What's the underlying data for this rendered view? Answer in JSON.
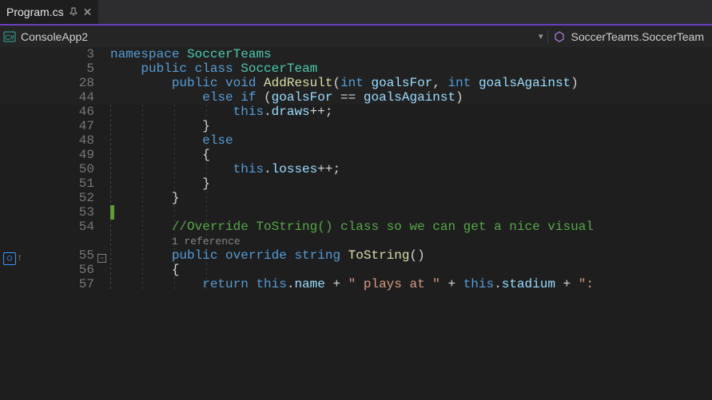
{
  "tab": {
    "name": "Program.cs",
    "pinned": true
  },
  "breadcrumb": {
    "project_icon": "csharp-project-icon",
    "project": "ConsoleApp2",
    "symbol_icon": "method-icon",
    "symbol": "SoccerTeams.SoccerTeam"
  },
  "sticky_lines": [
    {
      "num": 3,
      "tokens": [
        [
          "kw",
          "namespace"
        ],
        [
          "pun",
          " "
        ],
        [
          "type",
          "SoccerTeams"
        ]
      ],
      "indent": 0
    },
    {
      "num": 5,
      "tokens": [
        [
          "kw",
          "public"
        ],
        [
          "pun",
          " "
        ],
        [
          "kw",
          "class"
        ],
        [
          "pun",
          " "
        ],
        [
          "type",
          "SoccerTeam"
        ]
      ],
      "indent": 1
    },
    {
      "num": 28,
      "tokens": [
        [
          "kw",
          "public"
        ],
        [
          "pun",
          " "
        ],
        [
          "kw",
          "void"
        ],
        [
          "pun",
          " "
        ],
        [
          "meth",
          "AddResult"
        ],
        [
          "pun",
          "("
        ],
        [
          "kw",
          "int"
        ],
        [
          "pun",
          " "
        ],
        [
          "var",
          "goalsFor"
        ],
        [
          "pun",
          ", "
        ],
        [
          "kw",
          "int"
        ],
        [
          "pun",
          " "
        ],
        [
          "var",
          "goalsAgainst"
        ],
        [
          "pun",
          ")"
        ]
      ],
      "indent": 2
    },
    {
      "num": 44,
      "tokens": [
        [
          "kw",
          "else"
        ],
        [
          "pun",
          " "
        ],
        [
          "kw",
          "if"
        ],
        [
          "pun",
          " ("
        ],
        [
          "var",
          "goalsFor"
        ],
        [
          "pun",
          " == "
        ],
        [
          "var",
          "goalsAgainst"
        ],
        [
          "pun",
          ")"
        ]
      ],
      "indent": 3
    }
  ],
  "lines": [
    {
      "num": 46,
      "tokens": [
        [
          "kw",
          "this"
        ],
        [
          "pun",
          "."
        ],
        [
          "var",
          "draws"
        ],
        [
          "pun",
          "++;"
        ]
      ],
      "indent": 4
    },
    {
      "num": 47,
      "tokens": [
        [
          "pun",
          "}"
        ]
      ],
      "indent": 3
    },
    {
      "num": 48,
      "tokens": [
        [
          "kw",
          "else"
        ]
      ],
      "indent": 3
    },
    {
      "num": 49,
      "tokens": [
        [
          "pun",
          "{"
        ]
      ],
      "indent": 3
    },
    {
      "num": 50,
      "tokens": [
        [
          "kw",
          "this"
        ],
        [
          "pun",
          "."
        ],
        [
          "var",
          "losses"
        ],
        [
          "pun",
          "++;"
        ]
      ],
      "indent": 4
    },
    {
      "num": 51,
      "tokens": [
        [
          "pun",
          "}"
        ]
      ],
      "indent": 3
    },
    {
      "num": 52,
      "tokens": [
        [
          "pun",
          "}"
        ]
      ],
      "indent": 2
    },
    {
      "num": 53,
      "tokens": [],
      "indent": 2,
      "changeBar": true
    },
    {
      "num": 54,
      "tokens": [
        [
          "com",
          "//Override ToString() class so we can get a nice visual"
        ]
      ],
      "indent": 2
    },
    {
      "num": null,
      "tokens": [
        [
          "lens",
          "1 reference"
        ]
      ],
      "indent": 2,
      "isLens": true
    },
    {
      "num": 55,
      "tokens": [
        [
          "kw",
          "public"
        ],
        [
          "pun",
          " "
        ],
        [
          "kw",
          "override"
        ],
        [
          "pun",
          " "
        ],
        [
          "kw",
          "string"
        ],
        [
          "pun",
          " "
        ],
        [
          "meth",
          "ToString"
        ],
        [
          "pun",
          "()"
        ]
      ],
      "indent": 2,
      "fold": true,
      "overrideGlyph": true
    },
    {
      "num": 56,
      "tokens": [
        [
          "pun",
          "{"
        ]
      ],
      "indent": 2
    },
    {
      "num": 57,
      "tokens": [
        [
          "kw",
          "return"
        ],
        [
          "pun",
          " "
        ],
        [
          "kw",
          "this"
        ],
        [
          "pun",
          "."
        ],
        [
          "var",
          "name"
        ],
        [
          "pun",
          " + "
        ],
        [
          "str",
          "\" plays at \""
        ],
        [
          "pun",
          " + "
        ],
        [
          "kw",
          "this"
        ],
        [
          "pun",
          "."
        ],
        [
          "var",
          "stadium"
        ],
        [
          "pun",
          " + "
        ],
        [
          "str",
          "\":"
        ]
      ],
      "indent": 3
    }
  ],
  "codelens_label": "1 reference"
}
